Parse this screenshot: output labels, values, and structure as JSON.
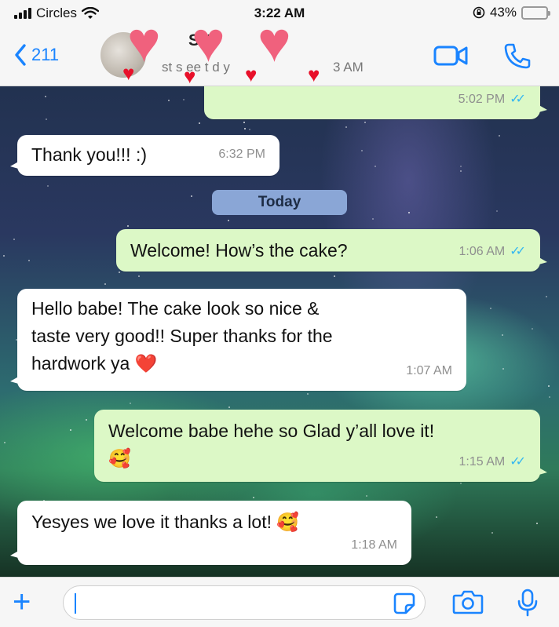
{
  "status_bar": {
    "carrier": "Circles",
    "time": "3:22 AM",
    "battery_percent": "43%",
    "battery_level": 0.43
  },
  "header": {
    "back_count": "211",
    "contact_name": "S O",
    "contact_status_fragment_1": "st s ee t d y",
    "contact_status_fragment_2": "3 AM",
    "video_icon": "video-camera-icon",
    "call_icon": "phone-icon"
  },
  "chat": {
    "day_separator": "Today",
    "messages": [
      {
        "direction": "out",
        "text": "",
        "time": "5:02 PM",
        "ticks": "✓✓"
      },
      {
        "direction": "in",
        "text": "Thank you!!! :)",
        "time": "6:32 PM"
      },
      {
        "direction": "out",
        "text": "Welcome! How’s the cake?",
        "time": "1:06 AM",
        "ticks": "✓✓"
      },
      {
        "direction": "in",
        "text": "Hello babe! The cake look so nice &\ntaste very good!! Super thanks for the\nhardwork ya ❤️",
        "time": "1:07 AM"
      },
      {
        "direction": "out",
        "text": "Welcome babe hehe so Glad y’all love it!\n🥰",
        "time": "1:15 AM",
        "ticks": "✓✓"
      },
      {
        "direction": "in",
        "text": "Yesyes we love it thanks a lot! 🥰",
        "time": "1:18 AM"
      }
    ]
  },
  "input_bar": {
    "plus_label": "+",
    "message_value": "",
    "sticker_icon": "sticker-icon",
    "camera_icon": "camera-icon",
    "mic_icon": "microphone-icon"
  },
  "colors": {
    "accent": "#1a84ff",
    "outgoing_bubble": "#dcf8c6",
    "incoming_bubble": "#ffffff",
    "read_ticks": "#34b7f1",
    "hearts_overlay": "#f0617d",
    "small_hearts": "#e8102a"
  }
}
